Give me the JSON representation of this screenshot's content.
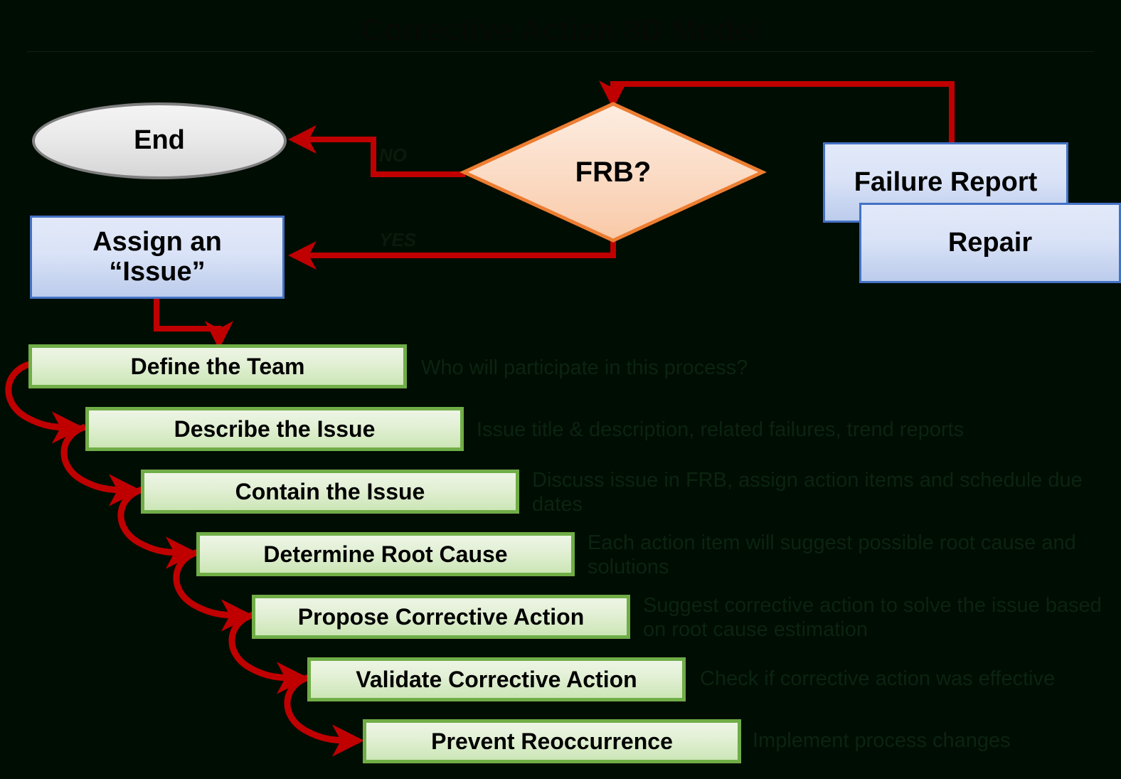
{
  "title": "Corrective Action 8D Model",
  "colors": {
    "background": "#000d03",
    "arrow_red": "#C00000",
    "blue_border": "#4472C4",
    "green_border": "#70AD47",
    "orange_border": "#ED7D31",
    "gray_border": "#808080"
  },
  "nodes": {
    "end": "End",
    "frb": "FRB?",
    "failure_report": "Failure Report",
    "repair": "Repair",
    "assign_issue": "Assign an\n“Issue”",
    "assign_issue_line1": "Assign an",
    "assign_issue_line2": "“Issue”"
  },
  "edge_labels": {
    "no": "NO",
    "yes": "YES"
  },
  "steps": [
    {
      "label": "Define the Team",
      "note": "Who will participate in this process?"
    },
    {
      "label": "Describe the Issue",
      "note": "Issue title & description, related failures, trend reports"
    },
    {
      "label": "Contain the Issue",
      "note": "Discuss issue in FRB, assign action items and schedule due dates"
    },
    {
      "label": "Determine Root Cause",
      "note": "Each action item will suggest possible root cause and solutions"
    },
    {
      "label": "Propose Corrective Action",
      "note": "Suggest corrective action to solve the issue based on root cause estimation"
    },
    {
      "label": "Validate Corrective Action",
      "note": "Check if corrective action was effective"
    },
    {
      "label": "Prevent Reoccurrence",
      "note": "Implement process changes"
    }
  ]
}
